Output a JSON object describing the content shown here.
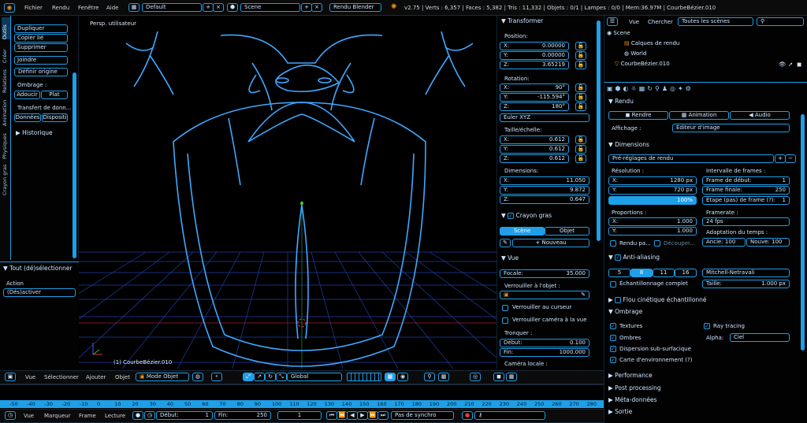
{
  "topbar": {
    "menus": [
      "Fichier",
      "Rendu",
      "Fenêtre",
      "Aide"
    ],
    "layout": "Default",
    "scene": "Scene",
    "engine": "Rendu Blender",
    "stats": "v2.75 | Verts : 6,357 | Faces : 5,382 | Tris : 11,332 | Objets : 0/1 | Lampes : 0/0 | Mem:36.97M | CourbeBézier.010"
  },
  "toolshelf": {
    "tabs": [
      "Outils",
      "Créer",
      "Relations",
      "Animation",
      "Physiques",
      "Crayon gras"
    ],
    "buttons": [
      "Dupliquer",
      "Copier lié",
      "Supprimer",
      "Joindre"
    ],
    "origin": "Définir origine",
    "shading_label": "Ombrage :",
    "smooth": "Adoucir",
    "flat": "Plat",
    "transfer_label": "Transfert de donn...",
    "data": "Données",
    "disposition": "Dispositi",
    "history": "Historique",
    "operator_title": "Tout (dé)sélectionner",
    "action_label": "Action",
    "action_value": "(Dés)activer"
  },
  "viewport": {
    "view_label": "Persp. utilisateur",
    "object_label": "(1) CourbeBézier.010"
  },
  "properties": {
    "transform_title": "Transformer",
    "position_label": "Position:",
    "position": [
      {
        "k": "X:",
        "v": "0.00000"
      },
      {
        "k": "Y:",
        "v": "0.00000"
      },
      {
        "k": "Z:",
        "v": "3.65219"
      }
    ],
    "rotation_label": "Rotation:",
    "rotation": [
      {
        "k": "X:",
        "v": "90°"
      },
      {
        "k": "Y:",
        "v": "-115.594°"
      },
      {
        "k": "Z:",
        "v": "180°"
      }
    ],
    "euler": "Euler XYZ",
    "scale_label": "Taille/échelle:",
    "scale": [
      {
        "k": "X:",
        "v": "0.612"
      },
      {
        "k": "Y:",
        "v": "0.612"
      },
      {
        "k": "Z:",
        "v": "0.612"
      }
    ],
    "dimensions_label": "Dimensions:",
    "dimensions": [
      {
        "k": "X:",
        "v": "11.050"
      },
      {
        "k": "Y:",
        "v": "9.872"
      },
      {
        "k": "Z:",
        "v": "0.647"
      }
    ],
    "grease_title": "Crayon gras",
    "scene_btn": "Scène",
    "object_btn": "Objet",
    "new_btn": "Nouveau",
    "view_title": "Vue",
    "focal_label": "Focale:",
    "focal_value": "35.000",
    "lock_object_label": "Verrouiller à l'objet :",
    "lock_cursor": "Verrouiller au curseur",
    "lock_camera": "Verrouiller caméra à la vue",
    "clip_label": "Tronquer :",
    "clip_start_label": "Début:",
    "clip_start": "0.100",
    "clip_end_label": "Fin:",
    "clip_end": "1000.000",
    "local_camera": "Caméra locale :"
  },
  "outliner": {
    "view": "Vue",
    "search": "Chercher",
    "all_scenes": "Toutes les scènes",
    "items": [
      "Scene",
      "Calques de rendu",
      "World",
      "CourbeBézier.010"
    ]
  },
  "render": {
    "title": "Rendu",
    "render_btn": "Rendre",
    "animation_btn": "Animation",
    "audio_btn": "Audio",
    "display_label": "Affichage :",
    "display_value": "Éditeur d'image",
    "dimensions_title": "Dimensions",
    "presets": "Pré-réglages de rendu",
    "resolution_label": "Résolution :",
    "res_x_label": "X:",
    "res_x": "1280 px",
    "res_y_label": "Y:",
    "res_y": "720 px",
    "res_pct": "100%",
    "frame_range_label": "Intervalle de frames :",
    "frame_start_label": "Frame de début:",
    "frame_start": "1",
    "frame_end_label": "Frame finale:",
    "frame_end": "250",
    "frame_step_label": "Étape (pas) de frame (?):",
    "frame_step": "1",
    "aspect_label": "Proportions :",
    "aspect_x": "1.000",
    "aspect_y": "1.000",
    "framerate_label": "Framerate :",
    "framerate": "24 fps",
    "time_remap_label": "Adaptation du temps :",
    "old_label": "Ancie:",
    "old": "100",
    "new_label": "Nouve:",
    "new": "100",
    "border": "Rendu pa...",
    "crop": "Découper...",
    "aa_title": "Anti-aliasing",
    "aa_samples": [
      "5",
      "8",
      "11",
      "16"
    ],
    "aa_filter": "Mitchell-Netravali",
    "full_sample": "Échantillonnage complet",
    "size_label": "Taille:",
    "size_value": "1.000 px",
    "motion_blur": "Flou cinétique échantillonné",
    "shading_title": "Ombrage",
    "textures": "Textures",
    "shadows": "Ombres",
    "sss": "Dispersion sub-surfacique",
    "envmap": "Carte d'environnement (?)",
    "raytracing": "Ray tracing",
    "alpha_label": "Alpha:",
    "alpha_value": "Ciel",
    "performance": "Performance",
    "post": "Post processing",
    "metadata": "Méta-données",
    "output": "Sortie"
  },
  "view3d_header": {
    "menus": [
      "Vue",
      "Sélectionner",
      "Ajouter",
      "Objet"
    ],
    "mode": "Mode Objet",
    "orientation": "Global"
  },
  "timeline": {
    "ticks": [
      "-50",
      "-40",
      "-30",
      "-20",
      "-10",
      "0",
      "10",
      "20",
      "30",
      "40",
      "50",
      "60",
      "70",
      "80",
      "90",
      "100",
      "110",
      "120",
      "130",
      "140",
      "150",
      "160",
      "170",
      "180",
      "190",
      "200",
      "210",
      "220",
      "230",
      "240",
      "250",
      "260",
      "270",
      "280"
    ],
    "menus": [
      "Vue",
      "Marqueur",
      "Frame",
      "Lecture"
    ],
    "start_label": "Début:",
    "start": "1",
    "end_label": "Fin:",
    "end": "250",
    "current": "1",
    "sync": "Pas de synchro"
  },
  "colors": {
    "accent": "#1e9fe8",
    "bg": "#000000"
  }
}
